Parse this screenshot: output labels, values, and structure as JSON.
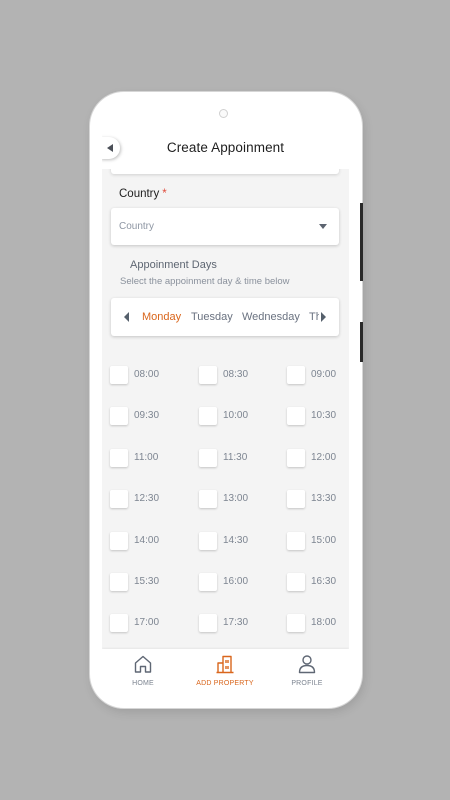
{
  "header": {
    "title": "Create Appoinment"
  },
  "country": {
    "label": "Country",
    "required_mark": "*",
    "placeholder": "Country"
  },
  "days_section": {
    "title": "Appoinment Days",
    "subtitle": "Select the appoinment day & time below"
  },
  "days": [
    "Monday",
    "Tuesday",
    "Wednesday",
    "Th"
  ],
  "selected_day": "Monday",
  "time_slots": [
    "08:00",
    "08:30",
    "09:00",
    "09:30",
    "10:00",
    "10:30",
    "11:00",
    "11:30",
    "12:00",
    "12:30",
    "13:00",
    "13:30",
    "14:00",
    "14:30",
    "15:00",
    "15:30",
    "16:00",
    "16:30",
    "17:00",
    "17:30",
    "18:00"
  ],
  "nav": [
    {
      "label": "HOME",
      "icon": "home-icon",
      "active": false
    },
    {
      "label": "ADD PROPERTY",
      "icon": "building-icon",
      "active": true
    },
    {
      "label": "PROFILE",
      "icon": "user-icon",
      "active": false
    }
  ],
  "colors": {
    "accent": "#d9661c",
    "required": "#e04c3c",
    "background": "#b3b3b3",
    "screen": "#f4f4f4"
  }
}
